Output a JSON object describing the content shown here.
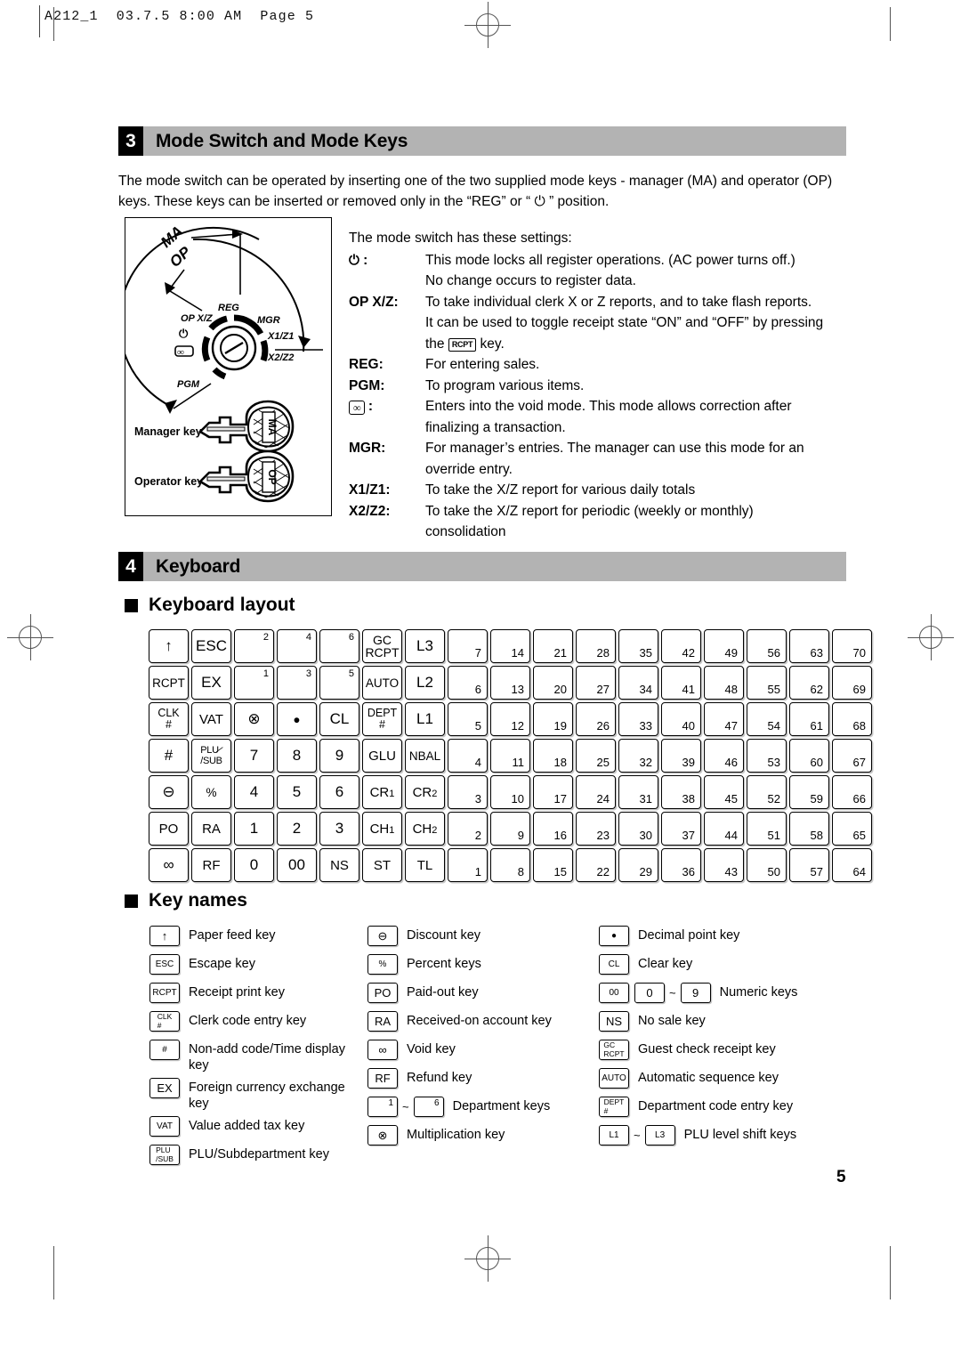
{
  "page_header": "A212_1  03.7.5 8:00 AM  Page 5",
  "page_number": "5",
  "section3": {
    "number": "3",
    "title": "Mode Switch and Mode Keys",
    "intro": "The mode switch can be operated by inserting one of the two supplied mode keys - manager (MA) and operator (OP) keys.  These keys can be inserted or removed only in the “REG” or “ ⏻ ” position.",
    "figure": {
      "dial_labels": [
        "MA",
        "OP",
        "REG",
        "MGR",
        "OP X/Z",
        "X1/Z1",
        "X2/Z2",
        "PGM"
      ],
      "manager_key_label": "Manager key (MA)",
      "manager_key_tag": "MA",
      "operator_key_label": "Operator key (OP)",
      "operator_key_tag": "OP"
    },
    "settings_intro": "The mode switch has these settings:",
    "settings": [
      {
        "term": "⏻ :",
        "term_type": "power",
        "lines": [
          "This mode locks all register operations. (AC power turns off.)",
          "No change occurs to register data."
        ]
      },
      {
        "term": "OP X/Z:",
        "term_type": "text",
        "lines": [
          "To take individual clerk X or Z reports, and to take flash reports.",
          "It can be used to toggle receipt state “ON” and “OFF” by pressing"
        ],
        "last_line_prefix": "the ",
        "last_line_key": "RCPT",
        "last_line_suffix": " key."
      },
      {
        "term": "REG:",
        "term_type": "text",
        "lines": [
          "For entering sales."
        ]
      },
      {
        "term": "PGM:",
        "term_type": "text",
        "lines": [
          "To program various items."
        ]
      },
      {
        "term": ":",
        "term_type": "void",
        "void_glyph": "∞",
        "lines": [
          "Enters into the void mode.  This mode allows correction after",
          "finalizing a transaction."
        ]
      },
      {
        "term": "MGR:",
        "term_type": "text",
        "lines": [
          "For manager’s entries.  The manager can use this mode for an",
          "override entry."
        ]
      },
      {
        "term": "X1/Z1:",
        "term_type": "text",
        "lines": [
          "To take the X/Z report for various daily totals"
        ]
      },
      {
        "term": "X2/Z2:",
        "term_type": "text",
        "lines": [
          "To take the X/Z report for periodic (weekly or monthly)",
          "consolidation"
        ]
      }
    ]
  },
  "section4": {
    "number": "4",
    "title": "Keyboard",
    "layout_heading": "Keyboard layout",
    "keynames_heading": "Key names"
  },
  "keyboard": {
    "main_rows": [
      [
        {
          "type": "glyph",
          "glyph": "↑",
          "name": "paper-feed"
        },
        {
          "type": "text",
          "label": "ESC",
          "name": "escape"
        },
        {
          "type": "corner",
          "corner": "2",
          "name": "dept-2"
        },
        {
          "type": "corner",
          "corner": "4",
          "name": "dept-4"
        },
        {
          "type": "corner",
          "corner": "6",
          "name": "dept-6"
        },
        {
          "type": "two",
          "line1": "GC",
          "line2": "RCPT",
          "name": "gc-rcpt"
        },
        {
          "type": "text",
          "label": "L3",
          "name": "level-3"
        }
      ],
      [
        {
          "type": "text",
          "label": "RCPT",
          "size": "sm13",
          "name": "receipt-print"
        },
        {
          "type": "text",
          "label": "EX",
          "name": "exchange"
        },
        {
          "type": "corner",
          "corner": "1",
          "name": "dept-1"
        },
        {
          "type": "corner",
          "corner": "3",
          "name": "dept-3"
        },
        {
          "type": "corner",
          "corner": "5",
          "name": "dept-5"
        },
        {
          "type": "text",
          "label": "AUTO",
          "size": "sm13",
          "name": "auto-sequence"
        },
        {
          "type": "text",
          "label": "L2",
          "name": "level-2"
        }
      ],
      [
        {
          "type": "stack",
          "line1": "CLK",
          "line2": "#",
          "name": "clerk-code"
        },
        {
          "type": "text",
          "label": "VAT",
          "size": "sm15",
          "name": "vat"
        },
        {
          "type": "glyph",
          "glyph": "⊗",
          "name": "multiplication"
        },
        {
          "type": "glyph",
          "glyph": "●",
          "size": "sm13",
          "name": "decimal-point"
        },
        {
          "type": "text",
          "label": "CL",
          "name": "clear"
        },
        {
          "type": "stack",
          "line1": "DEPT",
          "line2": "#",
          "name": "dept-code-entry"
        },
        {
          "type": "text",
          "label": "L1",
          "name": "level-1"
        }
      ],
      [
        {
          "type": "text",
          "label": "#",
          "name": "non-add-code"
        },
        {
          "type": "plusub",
          "name": "plu-sub"
        },
        {
          "type": "text",
          "label": "7",
          "name": "numeric-7"
        },
        {
          "type": "text",
          "label": "8",
          "name": "numeric-8"
        },
        {
          "type": "text",
          "label": "9",
          "name": "numeric-9"
        },
        {
          "type": "text",
          "label": "GLU",
          "size": "sm15",
          "name": "glu"
        },
        {
          "type": "text",
          "label": "NBAL",
          "size": "sm13",
          "name": "nbal"
        }
      ],
      [
        {
          "type": "glyph",
          "glyph": "⊖",
          "name": "discount"
        },
        {
          "type": "text",
          "label": "%",
          "size": "sm13",
          "name": "percent"
        },
        {
          "type": "text",
          "label": "4",
          "name": "numeric-4"
        },
        {
          "type": "text",
          "label": "5",
          "name": "numeric-5"
        },
        {
          "type": "text",
          "label": "6",
          "name": "numeric-6"
        },
        {
          "type": "sub",
          "label": "CR",
          "subn": "1",
          "name": "credit-1"
        },
        {
          "type": "sub",
          "label": "CR",
          "subn": "2",
          "name": "credit-2"
        }
      ],
      [
        {
          "type": "text",
          "label": "PO",
          "size": "sm15",
          "name": "paid-out"
        },
        {
          "type": "text",
          "label": "RA",
          "size": "sm15",
          "name": "received-on-account"
        },
        {
          "type": "text",
          "label": "1",
          "name": "numeric-1"
        },
        {
          "type": "text",
          "label": "2",
          "name": "numeric-2"
        },
        {
          "type": "text",
          "label": "3",
          "name": "numeric-3"
        },
        {
          "type": "sub",
          "label": "CH",
          "subn": "1",
          "name": "check-1"
        },
        {
          "type": "sub",
          "label": "CH",
          "subn": "2",
          "name": "check-2"
        }
      ],
      [
        {
          "type": "glyph",
          "glyph": "∞",
          "name": "void"
        },
        {
          "type": "text",
          "label": "RF",
          "size": "sm15",
          "name": "refund"
        },
        {
          "type": "text",
          "label": "0",
          "name": "numeric-0"
        },
        {
          "type": "text",
          "label": "00",
          "name": "numeric-00"
        },
        {
          "type": "text",
          "label": "NS",
          "size": "sm15",
          "name": "no-sale"
        },
        {
          "type": "text",
          "label": "ST",
          "size": "sm15",
          "name": "subtotal"
        },
        {
          "type": "text",
          "label": "TL",
          "size": "sm15",
          "name": "total"
        }
      ]
    ],
    "dept_rows": [
      [
        "7",
        "14",
        "21",
        "28",
        "35",
        "42",
        "49",
        "56",
        "63",
        "70"
      ],
      [
        "6",
        "13",
        "20",
        "27",
        "34",
        "41",
        "48",
        "55",
        "62",
        "69"
      ],
      [
        "5",
        "12",
        "19",
        "26",
        "33",
        "40",
        "47",
        "54",
        "61",
        "68"
      ],
      [
        "4",
        "11",
        "18",
        "25",
        "32",
        "39",
        "46",
        "53",
        "60",
        "67"
      ],
      [
        "3",
        "10",
        "17",
        "24",
        "31",
        "38",
        "45",
        "52",
        "59",
        "66"
      ],
      [
        "2",
        "9",
        "16",
        "23",
        "30",
        "37",
        "44",
        "51",
        "58",
        "65"
      ],
      [
        "1",
        "8",
        "15",
        "22",
        "29",
        "36",
        "43",
        "50",
        "57",
        "64"
      ]
    ]
  },
  "key_names": {
    "column1": [
      {
        "keys": [
          {
            "type": "glyph",
            "glyph": "↑",
            "name": "paper-feed-icon"
          }
        ],
        "text": "Paper feed key"
      },
      {
        "keys": [
          {
            "type": "text",
            "label": "ESC",
            "size": "tiny2",
            "name": "escape-icon"
          }
        ],
        "text": "Escape key"
      },
      {
        "keys": [
          {
            "type": "text",
            "label": "RCPT",
            "size": "tiny2",
            "name": "receipt-print-icon"
          }
        ],
        "text": "Receipt print key"
      },
      {
        "keys": [
          {
            "type": "stack",
            "line1": "CLK",
            "line2": "#",
            "name": "clerk-code-icon"
          }
        ],
        "text": "Clerk code entry key"
      },
      {
        "keys": [
          {
            "type": "text",
            "label": "#",
            "size": "tiny2",
            "name": "non-add-code-icon"
          }
        ],
        "text": "Non-add code/Time display key"
      },
      {
        "keys": [
          {
            "type": "text",
            "label": "EX",
            "name": "exchange-icon"
          }
        ],
        "text": "Foreign currency exchange key"
      },
      {
        "keys": [
          {
            "type": "text",
            "label": "VAT",
            "size": "tiny2",
            "name": "vat-icon"
          }
        ],
        "text": "Value added tax key"
      },
      {
        "keys": [
          {
            "type": "stack",
            "line1": "PLU",
            "line2": "/SUB",
            "name": "plu-sub-icon"
          }
        ],
        "text": "PLU/Subdepartment key"
      }
    ],
    "column2": [
      {
        "keys": [
          {
            "type": "glyph",
            "glyph": "⊖",
            "name": "discount-icon"
          }
        ],
        "text": "Discount key"
      },
      {
        "keys": [
          {
            "type": "text",
            "label": "%",
            "size": "tiny2",
            "name": "percent-icon"
          }
        ],
        "text": "Percent keys"
      },
      {
        "keys": [
          {
            "type": "text",
            "label": "PO",
            "name": "paid-out-icon"
          }
        ],
        "text": "Paid-out key"
      },
      {
        "keys": [
          {
            "type": "text",
            "label": "RA",
            "name": "received-on-account-icon"
          }
        ],
        "text": "Received-on account key"
      },
      {
        "keys": [
          {
            "type": "glyph",
            "glyph": "∞",
            "name": "void-icon"
          }
        ],
        "text": "Void key"
      },
      {
        "keys": [
          {
            "type": "text",
            "label": "RF",
            "name": "refund-icon"
          }
        ],
        "text": "Refund key"
      },
      {
        "keys": [
          {
            "type": "corner",
            "corner": "1",
            "name": "dept-1-icon"
          },
          {
            "type": "tilde"
          },
          {
            "type": "corner",
            "corner": "6",
            "name": "dept-6-icon"
          }
        ],
        "text": "Department keys"
      },
      {
        "keys": [
          {
            "type": "glyph",
            "glyph": "⊗",
            "name": "multiplication-icon"
          }
        ],
        "text": "Multiplication key"
      }
    ],
    "column3": [
      {
        "keys": [
          {
            "type": "glyph",
            "glyph": "●",
            "size": "tiny2",
            "name": "decimal-point-icon"
          }
        ],
        "text": "Decimal point key"
      },
      {
        "keys": [
          {
            "type": "text",
            "label": "CL",
            "size": "tiny2",
            "name": "clear-icon"
          }
        ],
        "text": "Clear key"
      },
      {
        "keys": [
          {
            "type": "text",
            "label": "00",
            "size": "tiny2",
            "name": "numeric-00-icon"
          },
          {
            "type": "gap"
          },
          {
            "type": "text",
            "label": "0",
            "name": "numeric-0-icon"
          },
          {
            "type": "tilde"
          },
          {
            "type": "text",
            "label": "9",
            "name": "numeric-9-icon"
          }
        ],
        "text": "Numeric keys"
      },
      {
        "keys": [
          {
            "type": "text",
            "label": "NS",
            "name": "no-sale-icon"
          }
        ],
        "text": "No sale key"
      },
      {
        "keys": [
          {
            "type": "stack",
            "line1": "GC",
            "line2": "RCPT",
            "name": "gc-rcpt-icon"
          }
        ],
        "text": "Guest check receipt key"
      },
      {
        "keys": [
          {
            "type": "text",
            "label": "AUTO",
            "size": "tiny2",
            "name": "auto-sequence-icon"
          }
        ],
        "text": "Automatic sequence key"
      },
      {
        "keys": [
          {
            "type": "stack",
            "line1": "DEPT",
            "line2": "#",
            "name": "dept-code-entry-icon"
          }
        ],
        "text": "Department code entry key"
      },
      {
        "keys": [
          {
            "type": "text",
            "label": "L1",
            "size": "tiny2",
            "name": "level-1-icon"
          },
          {
            "type": "tilde"
          },
          {
            "type": "text",
            "label": "L3",
            "size": "tiny2",
            "name": "level-3-icon"
          }
        ],
        "text": "PLU level shift keys"
      }
    ]
  }
}
